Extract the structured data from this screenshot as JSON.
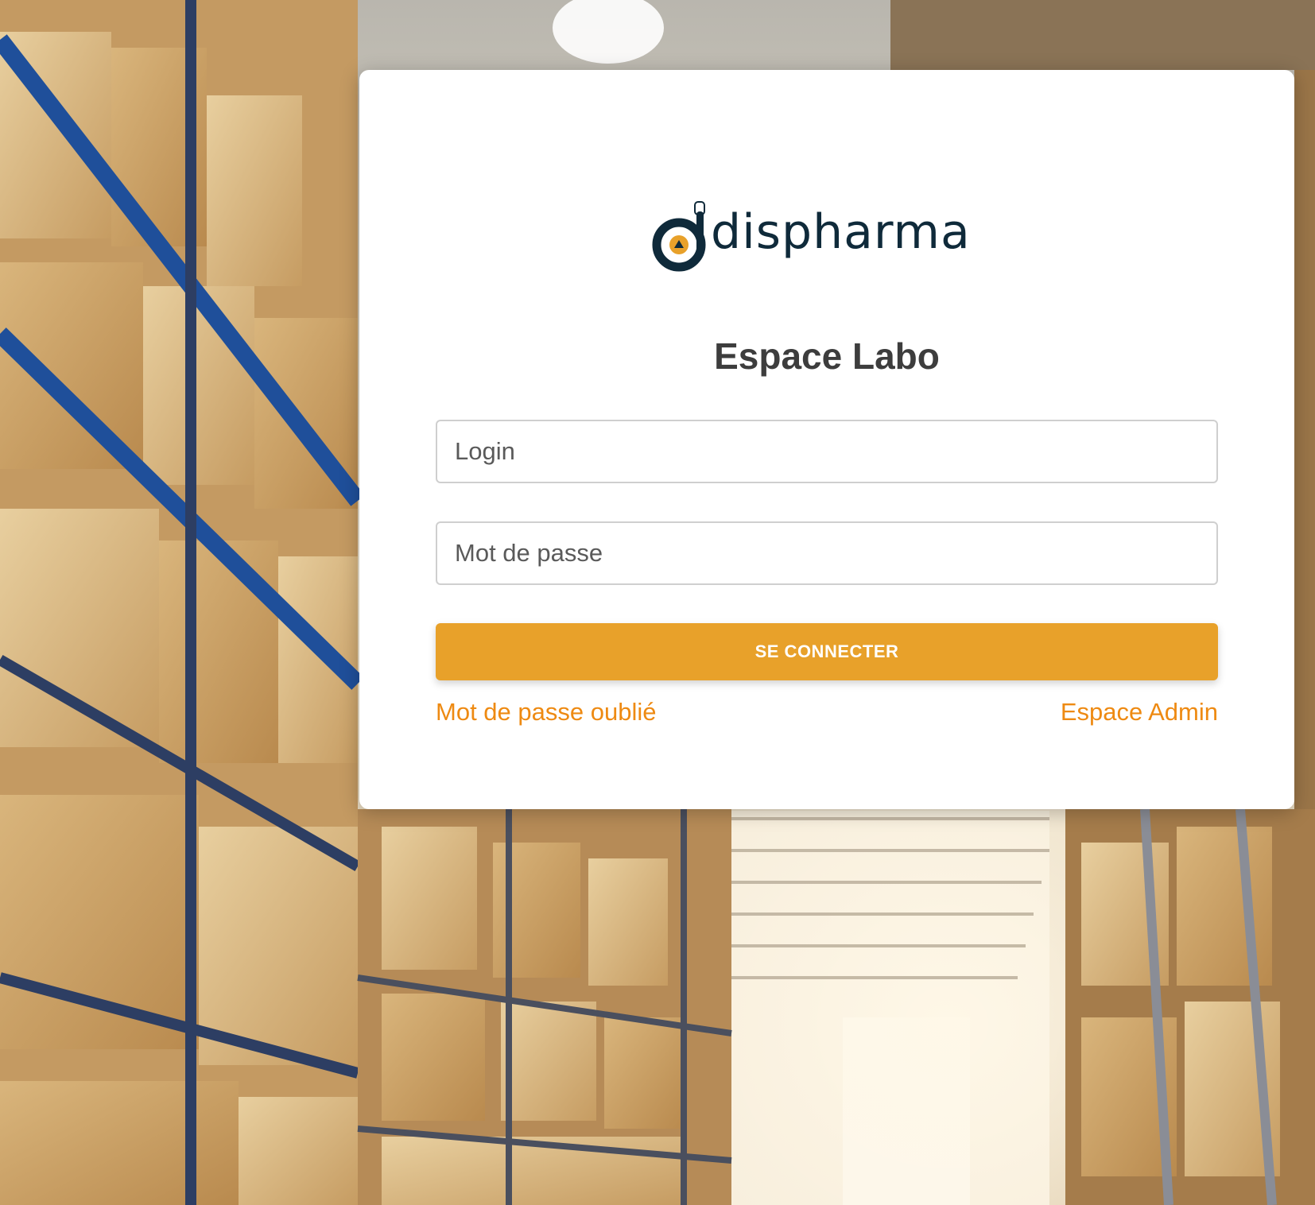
{
  "brand": {
    "logo_text": "dispharma",
    "colors": {
      "navy": "#0f2a3a",
      "accent": "#e8a12a",
      "link": "#ee8a12"
    }
  },
  "login_card": {
    "title": "Espace Labo",
    "login_placeholder": "Login",
    "password_placeholder": "Mot de passe",
    "submit_label": "SE CONNECTER",
    "forgot_password_label": "Mot de passe oublié",
    "admin_link_label": "Espace Admin"
  },
  "background": {
    "image_subject": "warehouse-shelves"
  }
}
